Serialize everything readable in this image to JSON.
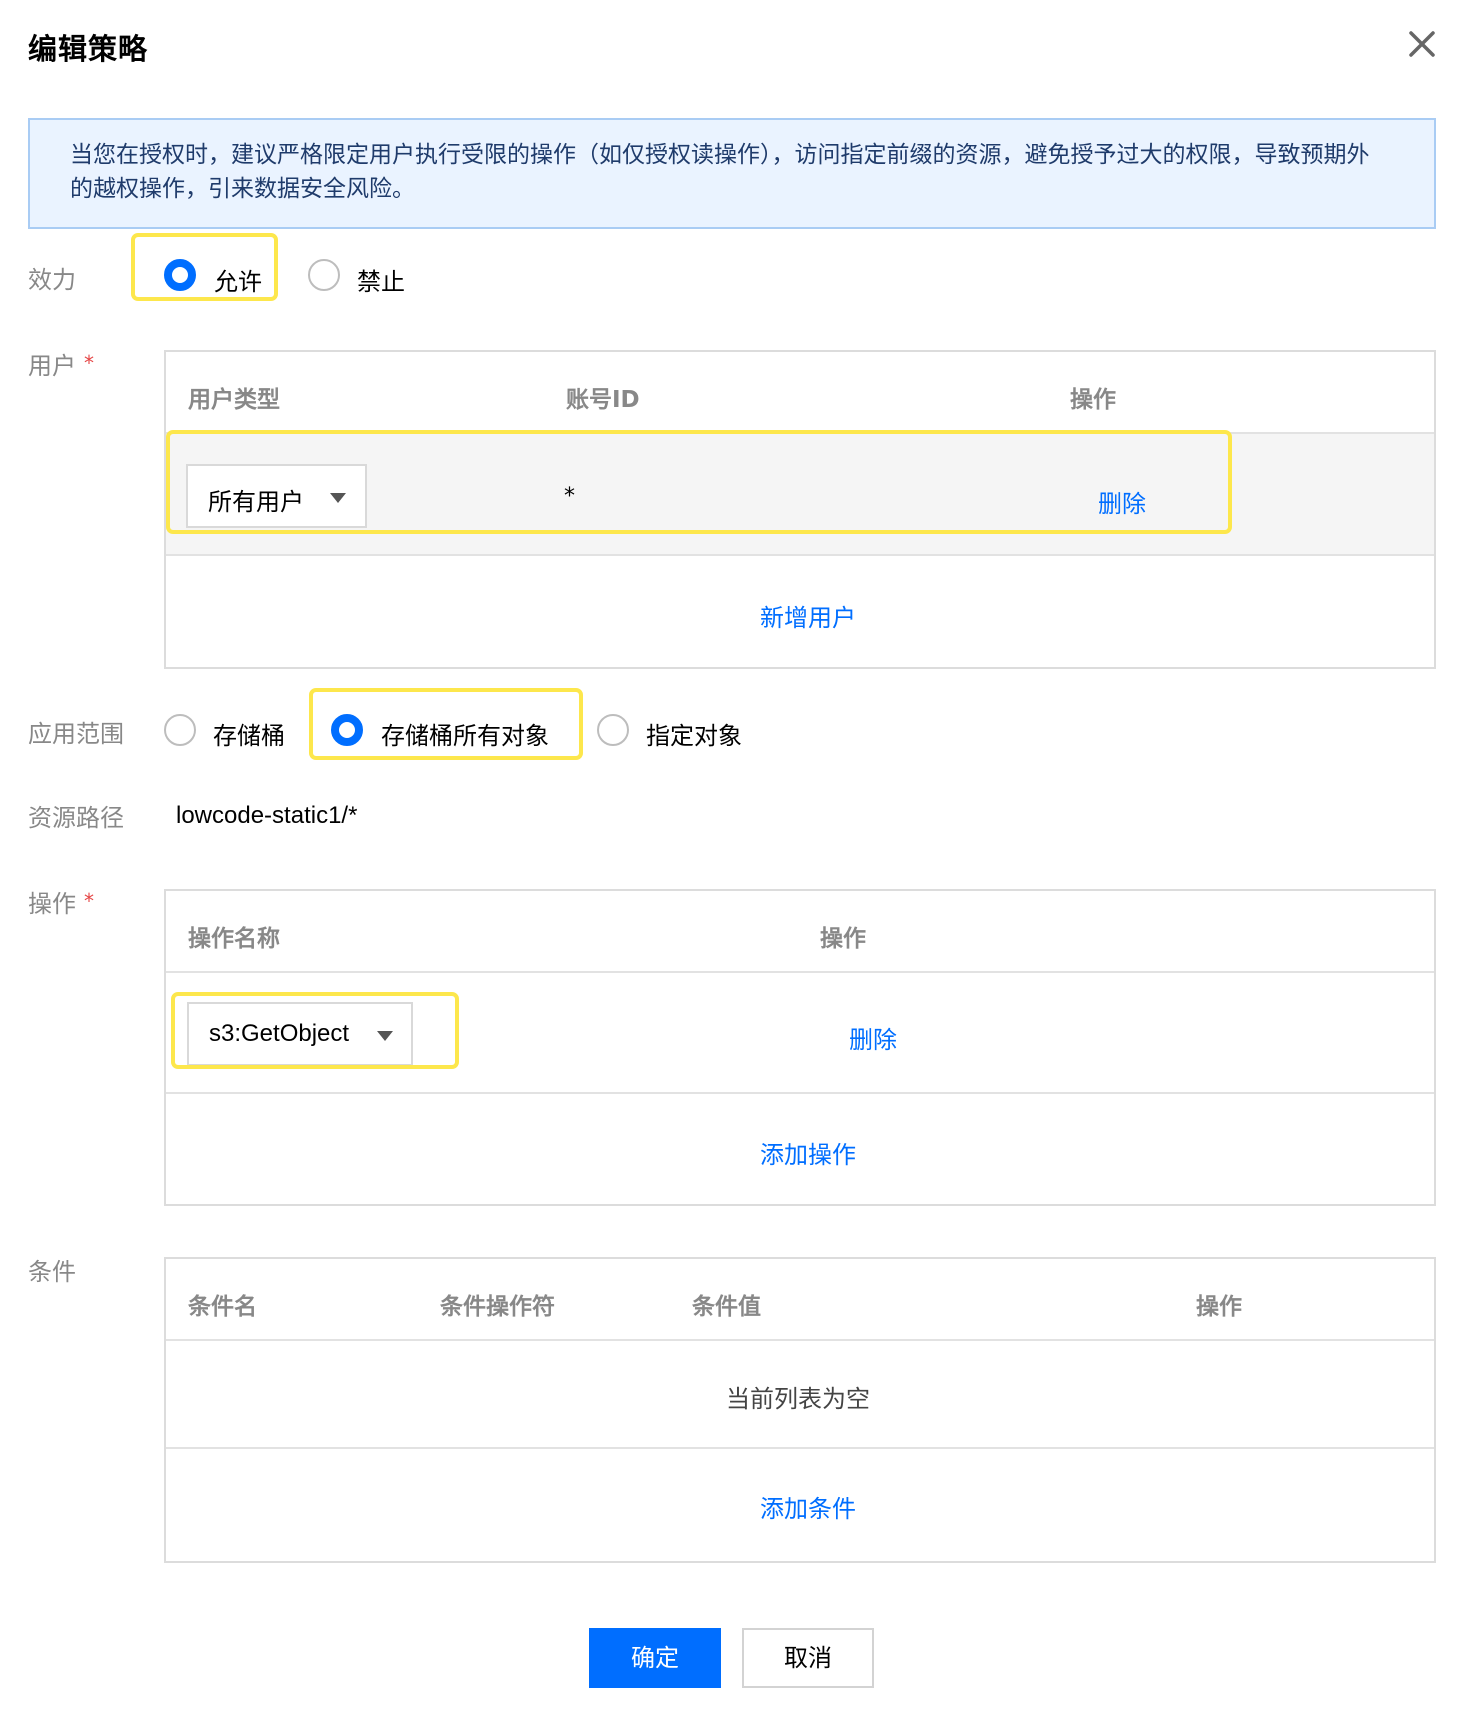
{
  "dialog": {
    "title": "编辑策略",
    "close_icon": "close-icon"
  },
  "notice": {
    "text": "当您在授权时，建议严格限定用户执行受限的操作（如仅授权读操作），访问指定前缀的资源，避免授予过大的权限，导致预期外的越权操作，引来数据安全风险。"
  },
  "effect": {
    "label": "效力",
    "options": [
      "允许",
      "禁止"
    ],
    "selected": "允许"
  },
  "users": {
    "label": "用户",
    "required_mark": "*",
    "headers": [
      "用户类型",
      "账号ID",
      "操作"
    ],
    "rows": [
      {
        "type": "所有用户",
        "account_id": "*",
        "action": "删除"
      }
    ],
    "add_label": "新增用户"
  },
  "scope": {
    "label": "应用范围",
    "options": [
      "存储桶",
      "存储桶所有对象",
      "指定对象"
    ],
    "selected": "存储桶所有对象"
  },
  "resource": {
    "label": "资源路径",
    "value": "lowcode-static1/*"
  },
  "operations": {
    "label": "操作",
    "required_mark": "*",
    "headers": [
      "操作名称",
      "操作"
    ],
    "rows": [
      {
        "name": "s3:GetObject",
        "action": "删除"
      }
    ],
    "add_label": "添加操作"
  },
  "conditions": {
    "label": "条件",
    "headers": [
      "条件名",
      "条件操作符",
      "条件值",
      "操作"
    ],
    "empty_text": "当前列表为空",
    "add_label": "添加条件"
  },
  "footer": {
    "confirm_label": "确定",
    "cancel_label": "取消"
  },
  "colors": {
    "primary": "#006eff",
    "highlight": "#fde74c",
    "notice_bg": "#eaf3ff",
    "required": "#e54545"
  }
}
